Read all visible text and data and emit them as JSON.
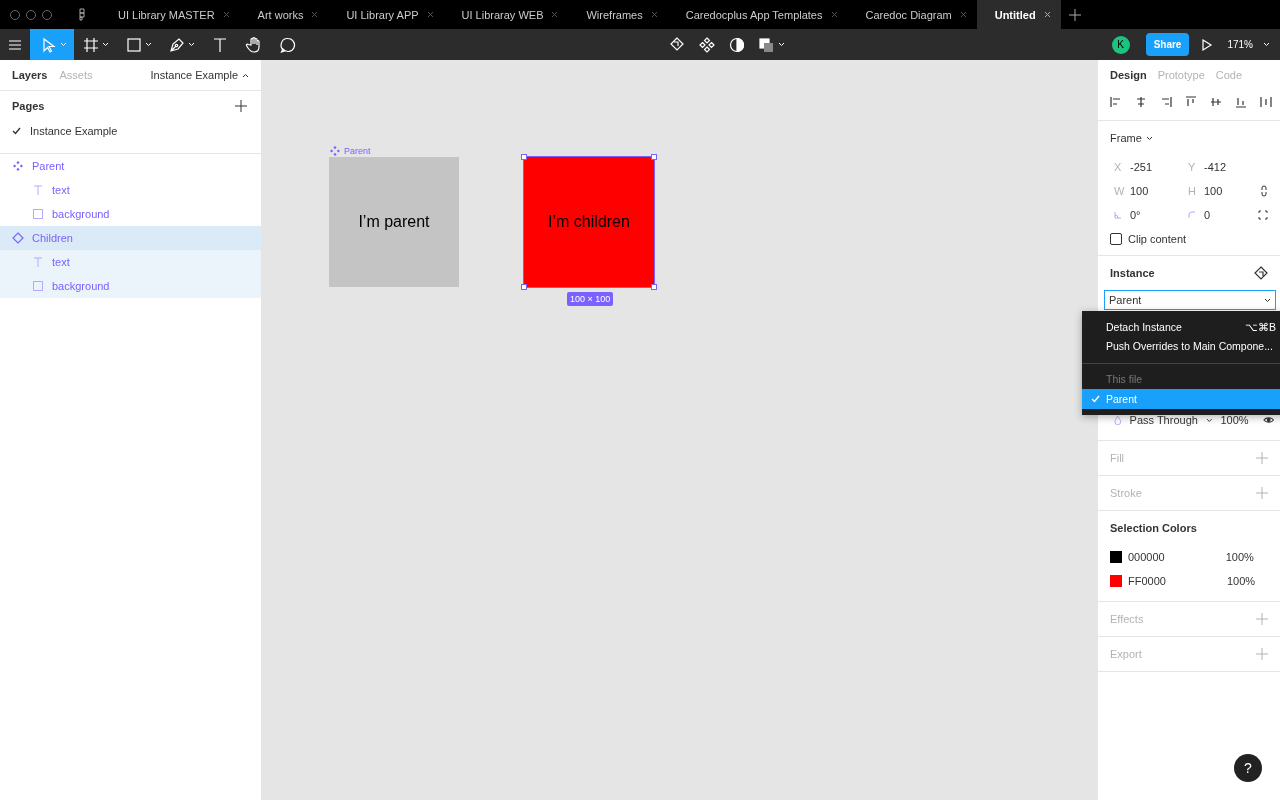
{
  "tabs": [
    {
      "label": "UI Library MASTER",
      "selected": false
    },
    {
      "label": "Art works",
      "selected": false
    },
    {
      "label": "UI Library APP",
      "selected": false
    },
    {
      "label": "UI Libraray WEB",
      "selected": false
    },
    {
      "label": "Wireframes",
      "selected": false
    },
    {
      "label": "Caredocplus App Templates",
      "selected": false
    },
    {
      "label": "Caredoc Diagram",
      "selected": false
    },
    {
      "label": "Untitled",
      "selected": true
    }
  ],
  "toolbar": {
    "tools": [
      {
        "selected": true,
        "menu": true
      },
      {
        "selected": false,
        "menu": true
      },
      {
        "selected": false,
        "menu": true
      },
      {
        "selected": false,
        "menu": true
      },
      {
        "selected": false,
        "menu": false
      },
      {
        "selected": false,
        "menu": false
      },
      {
        "selected": false,
        "menu": false
      }
    ],
    "avatar": "K",
    "share": "Share",
    "zoom": "171%"
  },
  "left_panel": {
    "tabs": [
      {
        "label": "Layers",
        "selected": true
      },
      {
        "label": "Assets",
        "selected": false
      }
    ],
    "page_selector": "Instance Example",
    "pages_title": "Pages",
    "pages": [
      {
        "label": "Instance Example",
        "selected": true
      }
    ],
    "layers": [
      {
        "name": "Parent",
        "kind": "component",
        "selected": false,
        "children": [
          {
            "name": "text",
            "kind": "text",
            "selected": false
          },
          {
            "name": "background",
            "kind": "rectangle",
            "selected": false
          }
        ]
      },
      {
        "name": "Children",
        "kind": "instance",
        "selected": true,
        "children": [
          {
            "name": "text",
            "kind": "text",
            "selected": false
          },
          {
            "name": "background",
            "kind": "rectangle",
            "selected": false
          }
        ]
      }
    ]
  },
  "canvas": {
    "frames": [
      {
        "label": "Parent",
        "text": "I’m parent",
        "color": "#c4c4c4",
        "selected": false
      },
      {
        "text": "I’m children",
        "color": "#ff0000",
        "selected": true,
        "size": "100 × 100"
      }
    ]
  },
  "right_panel": {
    "tabs": [
      {
        "label": "Design",
        "selected": true
      },
      {
        "label": "Prototype",
        "selected": false
      },
      {
        "label": "Code",
        "selected": false
      }
    ],
    "frame": {
      "title": "Frame",
      "fields": [
        {
          "label": "X",
          "value": "-251"
        },
        {
          "label": "Y",
          "value": "-412"
        },
        {
          "label": "W",
          "value": "100"
        },
        {
          "label": "H",
          "value": "100"
        },
        {
          "value": "0°"
        },
        {
          "value": "0"
        }
      ],
      "clip_content": {
        "label": "Clip content",
        "checked": false
      }
    },
    "instance": {
      "title": "Instance",
      "value": "Parent"
    },
    "menu": {
      "items": [
        {
          "label": "Detach Instance",
          "shortcut": "⌥⌘B"
        },
        {
          "label": "Push Overrides to Main Compone..."
        }
      ],
      "section_label": "This file",
      "options": [
        {
          "label": "Parent",
          "selected": true
        }
      ]
    },
    "layer": {
      "blend": "Pass Through",
      "opacity": "100%"
    },
    "fill": {
      "title": "Fill"
    },
    "stroke": {
      "title": "Stroke"
    },
    "selection_colors": {
      "title": "Selection Colors",
      "colors": [
        {
          "hex": "000000",
          "opacity": "100%",
          "color": "#000000"
        },
        {
          "hex": "FF0000",
          "opacity": "100%",
          "color": "#ff0000"
        }
      ]
    },
    "effects": {
      "title": "Effects"
    },
    "export": {
      "title": "Export"
    }
  },
  "help": "?"
}
